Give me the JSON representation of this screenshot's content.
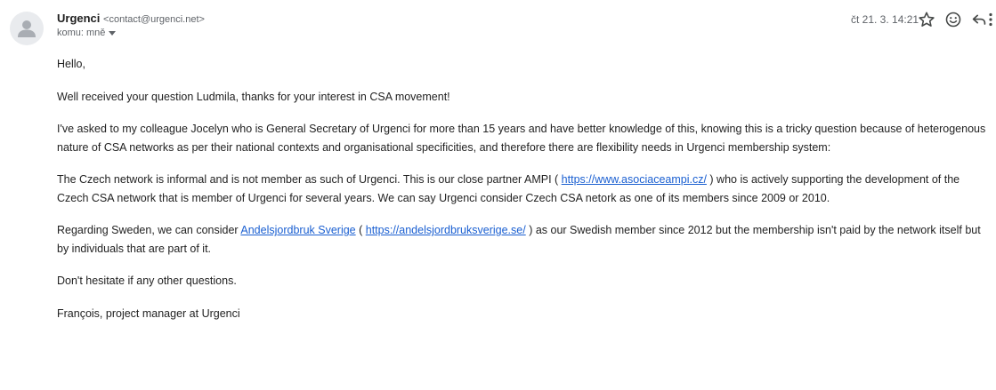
{
  "sender": {
    "name": "Urgenci",
    "email": "<contact@urgenci.net>",
    "to_label": "komu: mně"
  },
  "meta": {
    "date": "čt 21. 3. 14:21"
  },
  "icons": {
    "avatar": "person-icon",
    "star": "star-icon",
    "emoji": "emoji-icon",
    "reply": "reply-icon",
    "more": "more-vert-icon",
    "caret": "caret-down-icon"
  },
  "colors": {
    "link": "#1a5fd1",
    "muted": "#5f6368",
    "text": "#222222"
  },
  "body": {
    "greeting": "Hello,",
    "p1": "Well received your question Ludmila, thanks for your interest in CSA movement!",
    "p2": "I've asked to my colleague Jocelyn who is General Secretary of Urgenci for more than 15 years and have better knowledge of this, knowing this is a tricky question because of heterogenous nature of CSA networks as per their national contexts and organisational specificities, and therefore there are flexibility needs in Urgenci membership system:",
    "p3_a": "The Czech network is informal and is not member as such of Urgenci. This is our close partner AMPI ( ",
    "p3_link": "https://www.asociaceampi.cz/",
    "p3_b": " ) who is actively supporting the development of the Czech CSA network that is member of Urgenci for several years. We can say Urgenci consider Czech CSA netork as one of its members since 2009 or 2010.",
    "p4_a": "Regarding Sweden, we can consider ",
    "p4_link1": "Andelsjordbruk Sverige",
    "p4_b": " ( ",
    "p4_link2": "https://andelsjordbruksverige.se/",
    "p4_c": " ) as our Swedish member since 2012 but the membership isn't paid by the network itself but by individuals that are part of it.",
    "p5": "Don't hesitate if any other questions.",
    "signature": "François, project manager at Urgenci"
  }
}
